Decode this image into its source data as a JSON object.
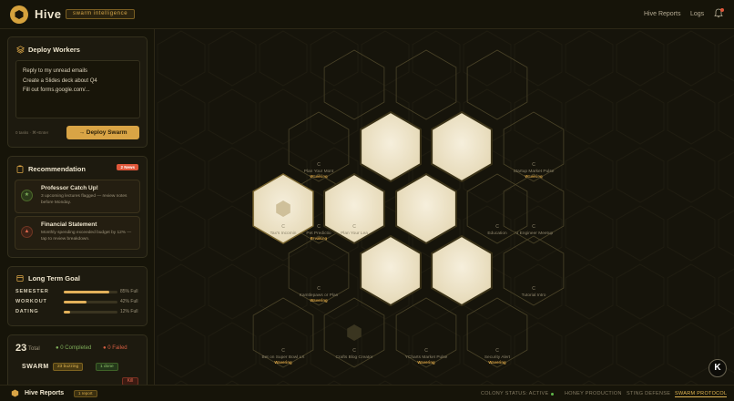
{
  "app": {
    "brand": "Hive",
    "tagline": "swarm intelligence",
    "nav": [
      "Hive Reports",
      "Logs"
    ]
  },
  "colors": {
    "accent": "#d9a445",
    "background": "#15130c",
    "alert": "#e0573a",
    "success": "#7fae5a"
  },
  "deploy": {
    "title": "Deploy Workers",
    "tasks": [
      "Reply to my unread emails",
      "Create a Slides deck about Q4",
      "Fill out forms.google.com/..."
    ],
    "hint": "0 tasks · ⌘+Enter",
    "button": "Deploy Swarm"
  },
  "recommendation": {
    "title": "Recommendation",
    "badge": "2 News",
    "items": [
      {
        "title": "Professor Catch Up!",
        "desc": "3 upcoming lectures flagged — review notes before Monday.",
        "icon": "star-icon"
      },
      {
        "title": "Financial Statement",
        "desc": "Monthly spending exceeded budget by 12% — tap to review breakdown.",
        "icon": "warning-icon"
      }
    ]
  },
  "goals": {
    "title": "Long Term Goal",
    "items": [
      {
        "label": "SEMESTER",
        "value": "85% Full",
        "fraction": 0.85
      },
      {
        "label": "WORKOUT",
        "value": "42% Full",
        "fraction": 0.42
      },
      {
        "label": "DATING",
        "value": "12% Full",
        "fraction": 0.12
      }
    ]
  },
  "stats": {
    "total": "23",
    "total_label": "Total",
    "completed": "0 Completed",
    "failed": "0 Failed",
    "swarm_label": "SWARM",
    "buzzing": "23 buzzing",
    "done": "1 done",
    "kill": "Kill"
  },
  "hive": {
    "cells": [
      {
        "id": "c1",
        "label": "",
        "state": "empty"
      },
      {
        "id": "c2",
        "label": "",
        "state": "empty"
      },
      {
        "id": "c3",
        "label": "",
        "state": "empty"
      },
      {
        "id": "c4",
        "label": "Plan Your Mont",
        "status": "Wavering",
        "state": "empty"
      },
      {
        "id": "c5",
        "label": "",
        "state": "active"
      },
      {
        "id": "c6",
        "label": "",
        "state": "active"
      },
      {
        "id": "c7",
        "label": "Startup Market Pulse",
        "status": "Wavering",
        "state": "empty"
      },
      {
        "id": "c8",
        "label": "Pet Predictio",
        "status": "Breaking",
        "state": "empty"
      },
      {
        "id": "c9",
        "label": "",
        "state": "selected"
      },
      {
        "id": "c10",
        "label": "",
        "state": "active"
      },
      {
        "id": "c11",
        "label": "",
        "state": "active"
      },
      {
        "id": "c12",
        "label": "AI Engineer Meetup",
        "state": "empty"
      },
      {
        "id": "c13",
        "label": "Tax's Incomin",
        "state": "empty"
      },
      {
        "id": "c14",
        "label": "Plan Your Lea",
        "state": "empty"
      },
      {
        "id": "c15",
        "label": "Education",
        "state": "empty"
      },
      {
        "id": "c16",
        "label": "",
        "state": "active"
      },
      {
        "id": "c17",
        "label": "",
        "state": "active"
      },
      {
        "id": "c18",
        "label": "Kamtlepaws or Plan",
        "status": "Wavering",
        "state": "empty"
      },
      {
        "id": "c19",
        "label": "Tutorial Intro",
        "state": "empty"
      },
      {
        "id": "c20",
        "label": "Bet on Super Bowl LX",
        "status": "Wavering",
        "state": "empty"
      },
      {
        "id": "c21",
        "label": "Crafts Blog Creator",
        "state": "empty"
      },
      {
        "id": "c22",
        "label": "YCharts Market Pulse",
        "status": "Wavering",
        "state": "empty"
      },
      {
        "id": "c23",
        "label": "Security Alert",
        "status": "Wavering",
        "state": "empty"
      }
    ]
  },
  "bottom": {
    "title": "Hive Reports",
    "pill": "1 report",
    "colony_status": "COLONY STATUS: ACTIVE",
    "tabs": [
      "HONEY PRODUCTION",
      "STING DEFENSE",
      "SWARM PROTOCOL"
    ],
    "active_tab": "SWARM PROTOCOL"
  },
  "assistant_button": "K"
}
